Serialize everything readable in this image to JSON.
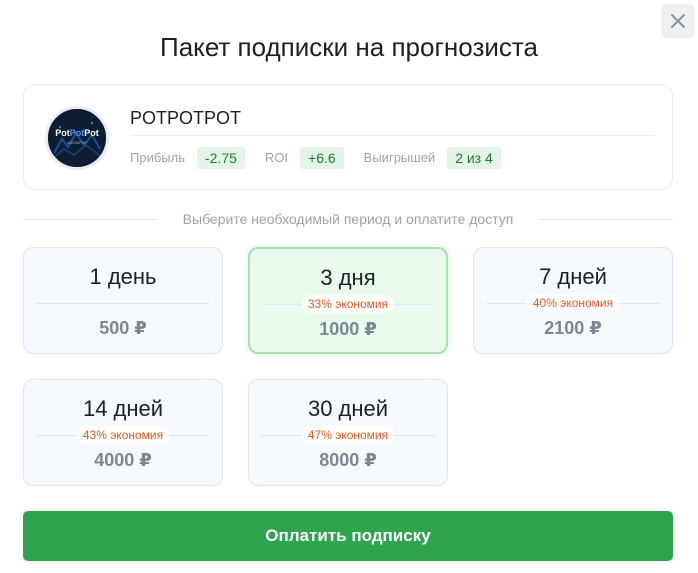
{
  "modal": {
    "title": "Пакет подписки на прогнозиста",
    "close_icon": "close-icon"
  },
  "forecaster": {
    "avatar_text": "PotPotPot",
    "username": "POTPOTPOT",
    "stats": [
      {
        "label": "Прибыль",
        "value": "-2.75"
      },
      {
        "label": "ROI",
        "value": "+6.6"
      },
      {
        "label": "Выигрышей",
        "value": "2 из 4"
      }
    ]
  },
  "period_hint": "Выберите необходимый период и оплатите доступ",
  "plans": [
    {
      "title": "1 день",
      "savings": "",
      "price": "500 ₽",
      "selected": false
    },
    {
      "title": "3 дня",
      "savings": "33% экономия",
      "price": "1000 ₽",
      "selected": true
    },
    {
      "title": "7 дней",
      "savings": "40% экономия",
      "price": "2100 ₽",
      "selected": false
    },
    {
      "title": "14 дней",
      "savings": "43% экономия",
      "price": "4000 ₽",
      "selected": false
    },
    {
      "title": "30 дней",
      "savings": "47% экономия",
      "price": "8000 ₽",
      "selected": false
    }
  ],
  "pay_button_label": "Оплатить подписку",
  "colors": {
    "accent_green": "#2fa44f",
    "savings_orange": "#e15a24",
    "stat_green": "#1f7a3a"
  }
}
